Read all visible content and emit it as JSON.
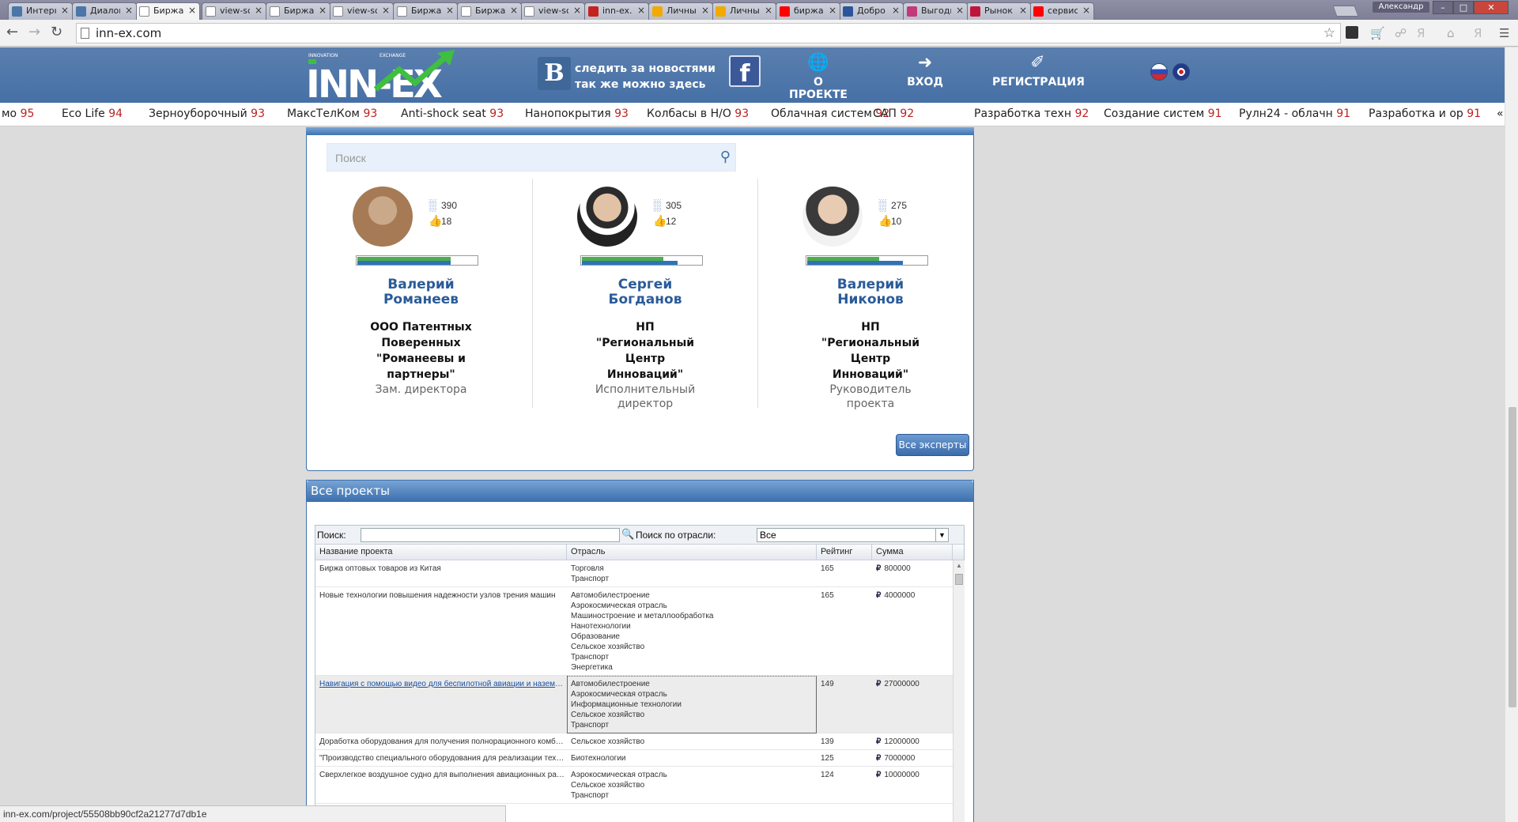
{
  "browser": {
    "tabs": [
      {
        "title": "Интерн",
        "icon": "vk-icon",
        "color": "#4a76a8"
      },
      {
        "title": "Диалоги",
        "icon": "vk-icon",
        "color": "#4a76a8"
      },
      {
        "title": "Биржа ",
        "icon": "page-icon",
        "color": "#ffffff"
      },
      {
        "title": "view-so",
        "icon": "page-icon",
        "color": "#ffffff"
      },
      {
        "title": "Биржа",
        "icon": "page-icon",
        "color": "#ffffff"
      },
      {
        "title": "view-so",
        "icon": "page-icon",
        "color": "#ffffff"
      },
      {
        "title": "Биржа",
        "icon": "page-icon",
        "color": "#ffffff"
      },
      {
        "title": "Биржа",
        "icon": "page-icon",
        "color": "#ffffff"
      },
      {
        "title": "view-sc",
        "icon": "page-icon",
        "color": "#ffffff"
      },
      {
        "title": "inn-ex.c",
        "icon": "gmail-icon",
        "color": "#c5221f"
      },
      {
        "title": "Личный",
        "icon": "a-icon",
        "color": "#f2a900"
      },
      {
        "title": "Личный",
        "icon": "a-icon",
        "color": "#f2a900"
      },
      {
        "title": "биржа",
        "icon": "yandex-icon",
        "color": "#ff0000"
      },
      {
        "title": "Добро",
        "icon": "qr-icon",
        "color": "#2a5699"
      },
      {
        "title": "Выгодн",
        "icon": "swirl-icon",
        "color": "#c23a7a"
      },
      {
        "title": "Рынок",
        "icon": "m-icon",
        "color": "#c0153a"
      },
      {
        "title": "сервис",
        "icon": "yandex-icon",
        "color": "#ff0000"
      }
    ],
    "user_name": "Александр",
    "url": "inn-ex.com",
    "status_url": "inn-ex.com/project/55508bb90cf2a21277d7db1e"
  },
  "header": {
    "logo_text": "INN-EX",
    "logo_small_left": "INNOVATION",
    "logo_small_right": "EXCHANGE",
    "vk_letter": "B",
    "vk_line1": "следить за новостями",
    "vk_line2": "так же можно здесь",
    "fb_letter": "f",
    "nav": [
      {
        "label": "О ПРОЕКТЕ",
        "icon": "globe-icon"
      },
      {
        "label": "ВХОД",
        "icon": "login-icon"
      },
      {
        "label": "РЕГИСТРАЦИЯ",
        "icon": "register-icon"
      }
    ]
  },
  "ticker": [
    {
      "name": "мо",
      "score": "95"
    },
    {
      "name": "Eco Life",
      "score": "94"
    },
    {
      "name": "Зерноуборочный",
      "score": "93"
    },
    {
      "name": "МаксТелКом",
      "score": "93"
    },
    {
      "name": "Anti-shock seat",
      "score": "93"
    },
    {
      "name": "Нанопокрытия",
      "score": "93"
    },
    {
      "name": "Колбасы в Н/О",
      "score": "93"
    },
    {
      "name": "Облачная систем",
      "score": "92"
    },
    {
      "name": "САП",
      "score": "92"
    },
    {
      "name": "Разработка техн",
      "score": "92"
    },
    {
      "name": "Создание систем",
      "score": "91"
    },
    {
      "name": "Рулн24 - облачн",
      "score": "91"
    },
    {
      "name": "Разработка и ор",
      "score": "91"
    }
  ],
  "experts": {
    "search_placeholder": "Поиск",
    "all_button": "Все эксперты",
    "items": [
      {
        "name": "Валерий Романеев",
        "org": "ООО Патентных Поверенных \"Романеевы и партнеры\"",
        "position": "Зам. директора",
        "stat1": "390",
        "stat2": "18",
        "bar_green": 0.78,
        "bar_blue": 0.78
      },
      {
        "name": "Сергей Богданов",
        "org": "НП \"Региональный Центр Инноваций\"",
        "position": "Исполнительный директор",
        "stat1": "305",
        "stat2": "12",
        "bar_green": 0.68,
        "bar_blue": 0.8
      },
      {
        "name": "Валерий Никонов",
        "org": "НП \"Региональный Центр Инноваций\"",
        "position": "Руководитель проекта",
        "stat1": "275",
        "stat2": "10",
        "bar_green": 0.6,
        "bar_blue": 0.8
      }
    ]
  },
  "projects": {
    "title": "Все проекты",
    "search_label": "Поиск:",
    "industry_label": "Поиск по отрасли:",
    "industry_value": "Все",
    "columns": [
      "Название проекта",
      "Отрасль",
      "Рейтинг",
      "Сумма"
    ],
    "rows": [
      {
        "name": "Биржа оптовых товаров из Китая",
        "industries": [
          "Торговля",
          "Транспорт"
        ],
        "rating": "165",
        "sum": "800000"
      },
      {
        "name": "Новые технологии повышения надежности узлов трения машин",
        "industries": [
          "Автомобилестроение",
          "Аэрокосмическая отрасль",
          "Машиностроение и металлообработка",
          "Нанотехнологии",
          "Образование",
          "Сельское хозяйство",
          "Транспорт",
          "Энергетика"
        ],
        "rating": "165",
        "sum": "4000000"
      },
      {
        "name": "Навигация с помощью видео для беспилотной авиации и наземного транспорта",
        "industries": [
          "Автомобилестроение",
          "Аэрокосмическая отрасль",
          "Информационные технологии",
          "Сельское хозяйство",
          "Транспорт"
        ],
        "rating": "149",
        "sum": "27000000",
        "selected": true
      },
      {
        "name": "Доработка оборудования для получения полнорационного комбикорма",
        "industries": [
          "Сельское хозяйство"
        ],
        "rating": "139",
        "sum": "12000000"
      },
      {
        "name": "\"Производство специального оборудования для реализации технологии",
        "industries": [
          "Биотехнологии"
        ],
        "rating": "125",
        "sum": "7000000"
      },
      {
        "name": "Сверхлегкое воздушное судно для выполнения авиационных работ",
        "industries": [
          "Аэрокосмическая отрасль",
          "Сельское хозяйство",
          "Транспорт"
        ],
        "rating": "124",
        "sum": "10000000"
      }
    ],
    "currency_symbol": "₽"
  }
}
